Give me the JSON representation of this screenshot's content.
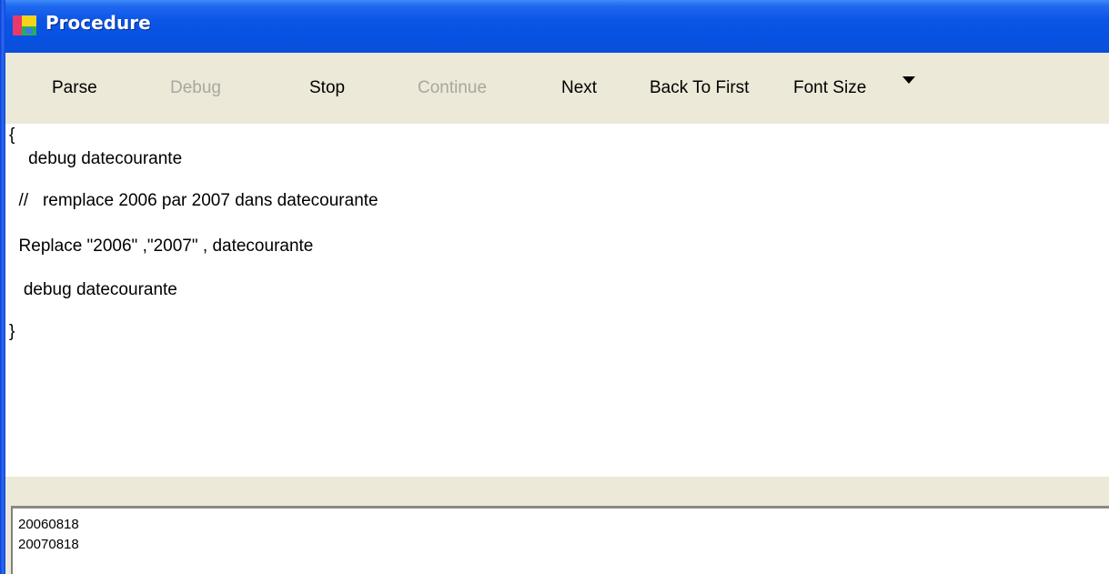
{
  "window": {
    "title": "Procedure"
  },
  "toolbar": {
    "parse": "Parse",
    "debug": "Debug",
    "stop": "Stop",
    "continue": "Continue",
    "next": "Next",
    "back_to_first": "Back To First",
    "font_size": "Font Size"
  },
  "editor": {
    "lines": [
      "{",
      "    debug datecourante",
      "  //   remplace 2006 par 2007 dans datecourante",
      "  Replace \"2006\" ,\"2007\" , datecourante",
      "   debug datecourante",
      "}"
    ]
  },
  "output": {
    "lines": [
      "20060818",
      "20070818"
    ]
  },
  "colors": {
    "title_bar": "#0a54e6",
    "window_bg": "#ece9d8",
    "disabled_text": "#a9a79f"
  }
}
